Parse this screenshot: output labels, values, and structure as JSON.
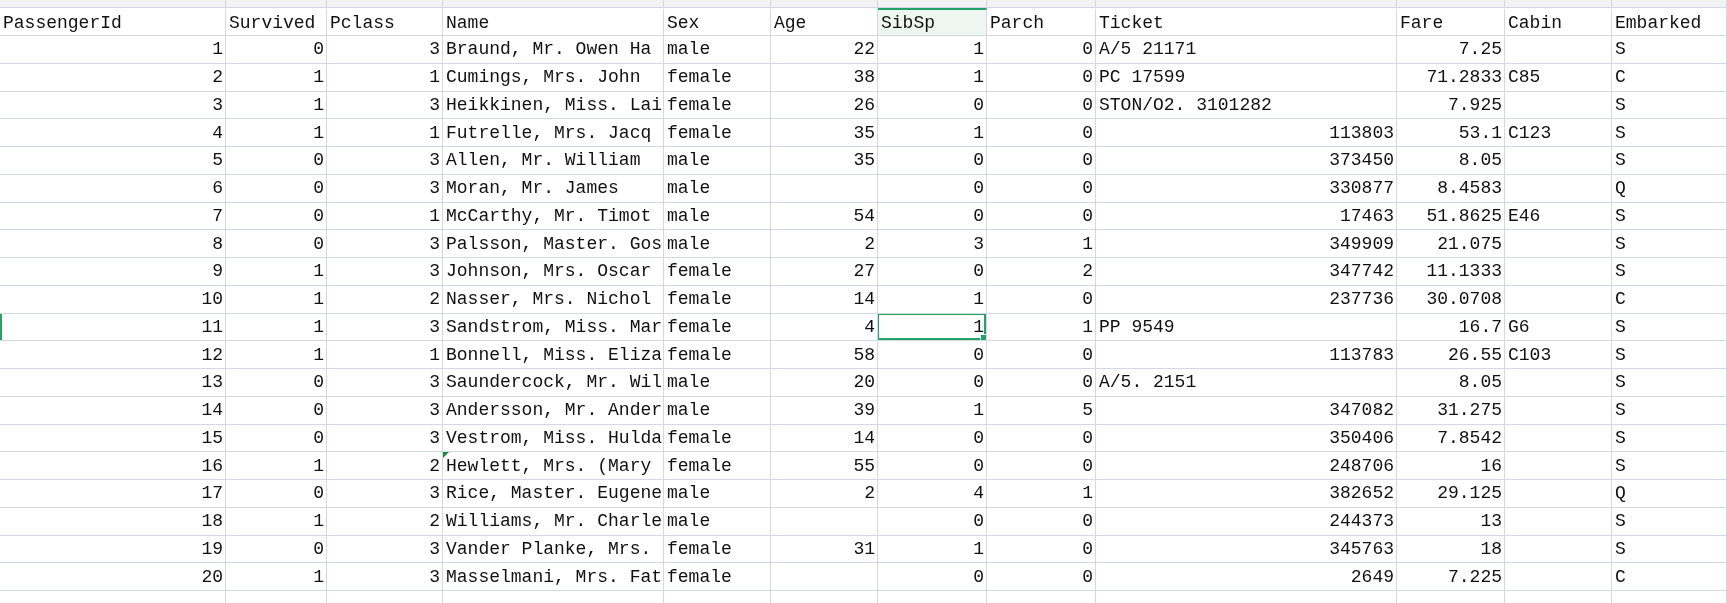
{
  "columns": [
    {
      "label": "PassengerId",
      "kind": "number",
      "selected": false
    },
    {
      "label": "Survived",
      "kind": "number",
      "selected": false
    },
    {
      "label": "Pclass",
      "kind": "number",
      "selected": false
    },
    {
      "label": "Name",
      "kind": "text",
      "selected": false
    },
    {
      "label": "Sex",
      "kind": "text",
      "selected": false
    },
    {
      "label": "Age",
      "kind": "number",
      "selected": false
    },
    {
      "label": "SibSp",
      "kind": "number",
      "selected": true
    },
    {
      "label": "Parch",
      "kind": "number",
      "selected": false
    },
    {
      "label": "Ticket",
      "selected": false
    },
    {
      "label": "Fare",
      "kind": "number",
      "selected": false
    },
    {
      "label": "Cabin",
      "kind": "text",
      "selected": false
    },
    {
      "label": "Embarked",
      "kind": "text",
      "selected": false
    }
  ],
  "rows": [
    {
      "cells": [
        "1",
        "0",
        "3",
        "Braund, Mr. Owen Ha",
        "male",
        "22",
        "1",
        "0",
        {
          "text": "A/5 21171",
          "kind": "text"
        },
        "7.25",
        null,
        "S"
      ],
      "selected": false,
      "comment": false
    },
    {
      "cells": [
        "2",
        "1",
        "1",
        "Cumings, Mrs. John",
        "female",
        "38",
        "1",
        "0",
        {
          "text": "PC 17599",
          "kind": "text"
        },
        "71.2833",
        "C85",
        "C"
      ],
      "selected": false,
      "comment": false
    },
    {
      "cells": [
        "3",
        "1",
        "3",
        "Heikkinen, Miss. Lai",
        "female",
        "26",
        "0",
        "0",
        {
          "text": "STON/O2. 3101282",
          "kind": "text"
        },
        "7.925",
        null,
        "S"
      ],
      "selected": false,
      "comment": false
    },
    {
      "cells": [
        "4",
        "1",
        "1",
        "Futrelle, Mrs. Jacq",
        "female",
        "35",
        "1",
        "0",
        {
          "text": "113803",
          "kind": "number"
        },
        "53.1",
        "C123",
        "S"
      ],
      "selected": false,
      "comment": false
    },
    {
      "cells": [
        "5",
        "0",
        "3",
        "Allen, Mr. William",
        "male",
        "35",
        "0",
        "0",
        {
          "text": "373450",
          "kind": "number"
        },
        "8.05",
        null,
        "S"
      ],
      "selected": false,
      "comment": false
    },
    {
      "cells": [
        "6",
        "0",
        "3",
        "Moran, Mr. James",
        "male",
        null,
        "0",
        "0",
        {
          "text": "330877",
          "kind": "number"
        },
        "8.4583",
        null,
        "Q"
      ],
      "selected": false,
      "comment": false
    },
    {
      "cells": [
        "7",
        "0",
        "1",
        "McCarthy, Mr. Timot",
        "male",
        "54",
        "0",
        "0",
        {
          "text": "17463",
          "kind": "number"
        },
        "51.8625",
        "E46",
        "S"
      ],
      "selected": false,
      "comment": false
    },
    {
      "cells": [
        "8",
        "0",
        "3",
        "Palsson, Master. Gos",
        "male",
        "2",
        "3",
        "1",
        {
          "text": "349909",
          "kind": "number"
        },
        "21.075",
        null,
        "S"
      ],
      "selected": false,
      "comment": false
    },
    {
      "cells": [
        "9",
        "1",
        "3",
        "Johnson, Mrs. Oscar",
        "female",
        "27",
        "0",
        "2",
        {
          "text": "347742",
          "kind": "number"
        },
        "11.1333",
        null,
        "S"
      ],
      "selected": false,
      "comment": false
    },
    {
      "cells": [
        "10",
        "1",
        "2",
        "Nasser, Mrs. Nichol",
        "female",
        "14",
        "1",
        "0",
        {
          "text": "237736",
          "kind": "number"
        },
        "30.0708",
        null,
        "C"
      ],
      "selected": false,
      "comment": false
    },
    {
      "cells": [
        "11",
        "1",
        "3",
        "Sandstrom, Miss. Mar",
        "female",
        "4",
        "1",
        "1",
        {
          "text": "PP 9549",
          "kind": "text"
        },
        "16.7",
        "G6",
        "S"
      ],
      "selected": true,
      "comment": false
    },
    {
      "cells": [
        "12",
        "1",
        "1",
        "Bonnell, Miss. Eliza",
        "female",
        "58",
        "0",
        "0",
        {
          "text": "113783",
          "kind": "number"
        },
        "26.55",
        "C103",
        "S"
      ],
      "selected": false,
      "comment": false
    },
    {
      "cells": [
        "13",
        "0",
        "3",
        "Saundercock, Mr. Wil",
        "male",
        "20",
        "0",
        "0",
        {
          "text": "A/5. 2151",
          "kind": "text"
        },
        "8.05",
        null,
        "S"
      ],
      "selected": false,
      "comment": false
    },
    {
      "cells": [
        "14",
        "0",
        "3",
        "Andersson, Mr. Ander",
        "male",
        "39",
        "1",
        "5",
        {
          "text": "347082",
          "kind": "number"
        },
        "31.275",
        null,
        "S"
      ],
      "selected": false,
      "comment": false
    },
    {
      "cells": [
        "15",
        "0",
        "3",
        "Vestrom, Miss. Hulda",
        "female",
        "14",
        "0",
        "0",
        {
          "text": "350406",
          "kind": "number"
        },
        "7.8542",
        null,
        "S"
      ],
      "selected": false,
      "comment": false
    },
    {
      "cells": [
        "16",
        "1",
        "2",
        "Hewlett, Mrs. (Mary",
        "female",
        "55",
        "0",
        "0",
        {
          "text": "248706",
          "kind": "number"
        },
        "16",
        null,
        "S"
      ],
      "selected": false,
      "comment": true
    },
    {
      "cells": [
        "17",
        "0",
        "3",
        "Rice, Master. Eugene",
        "male",
        "2",
        "4",
        "1",
        {
          "text": "382652",
          "kind": "number"
        },
        "29.125",
        null,
        "Q"
      ],
      "selected": false,
      "comment": false
    },
    {
      "cells": [
        "18",
        "1",
        "2",
        "Williams, Mr. Charle",
        "male",
        null,
        "0",
        "0",
        {
          "text": "244373",
          "kind": "number"
        },
        "13",
        null,
        "S"
      ],
      "selected": false,
      "comment": false
    },
    {
      "cells": [
        "19",
        "0",
        "3",
        "Vander Planke, Mrs.",
        "female",
        "31",
        "1",
        "0",
        {
          "text": "345763",
          "kind": "number"
        },
        "18",
        null,
        "S"
      ],
      "selected": false,
      "comment": false
    },
    {
      "cells": [
        "20",
        "1",
        "3",
        "Masselmani, Mrs. Fat",
        "female",
        null,
        "0",
        "0",
        {
          "text": "2649",
          "kind": "number"
        },
        "7.225",
        null,
        "C"
      ],
      "selected": false,
      "comment": false
    }
  ]
}
